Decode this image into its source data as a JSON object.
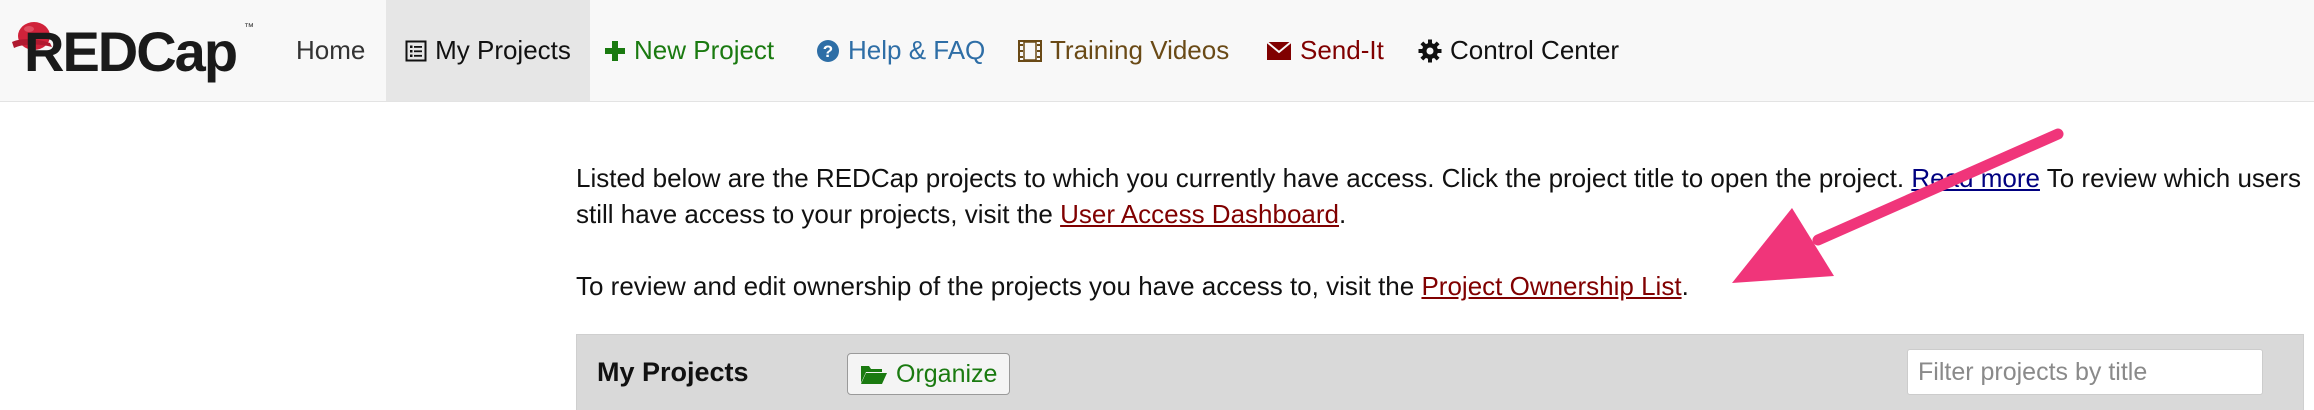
{
  "navbar": {
    "logo_text": "REDCap",
    "logo_tm": "™",
    "items": [
      {
        "label": "Home"
      },
      {
        "label": "My Projects"
      },
      {
        "label": "New Project"
      },
      {
        "label": "Help & FAQ"
      },
      {
        "label": "Training Videos"
      },
      {
        "label": "Send-It"
      },
      {
        "label": "Control Center"
      }
    ]
  },
  "content": {
    "para1_text_a": "Listed below are the REDCap projects to which you currently have access. Click the project title to open the project. ",
    "read_more_link": "Read more",
    "para1_text_b": " To review which users still have access to your projects, visit the ",
    "user_access_link": "User Access Dashboard",
    "para1_end": ".",
    "para2_text": "To review and edit ownership of the projects you have access to, visit the ",
    "ownership_link": "Project Ownership List",
    "para2_end": "."
  },
  "panel": {
    "title": "My Projects",
    "organize_label": "Organize",
    "filter_placeholder": "Filter projects by title"
  },
  "colors": {
    "nav_bg": "#f8f8f8",
    "active_tab_bg": "#e6e6e6",
    "new_project": "#1a7a10",
    "help": "#2e6ea6",
    "training": "#6a4a16",
    "sendit": "#800000",
    "link_red": "#800000",
    "link_navy": "#000080",
    "panel_bg": "#d9d9d9",
    "arrow": "#f0357a",
    "logo_cap": "#d0223a"
  },
  "icons": {
    "my_projects": "list-icon",
    "new_project": "plus-icon",
    "help": "question-circle-icon",
    "training": "film-icon",
    "sendit": "envelope-icon",
    "control_center": "gear-icon",
    "organize": "folder-open-icon"
  }
}
